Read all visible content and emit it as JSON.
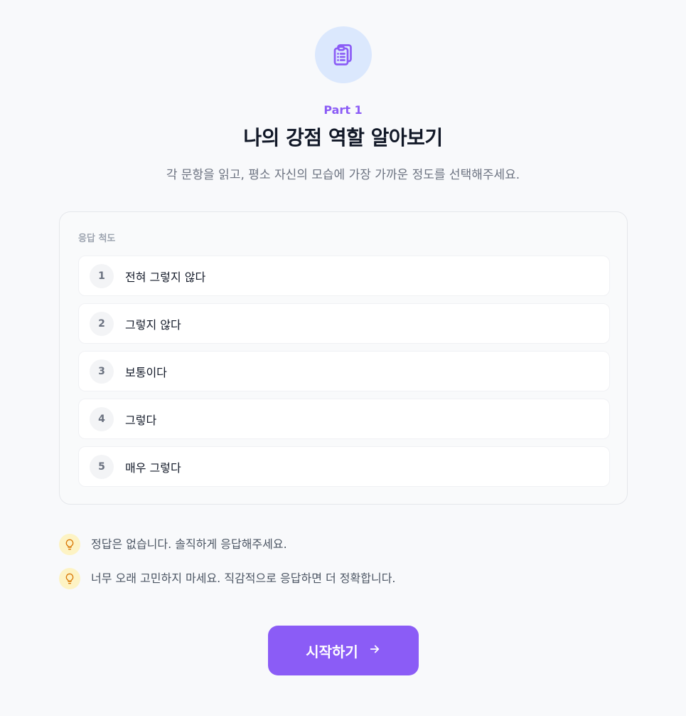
{
  "header": {
    "icon": "clipboard-list-icon",
    "part_label": "Part 1",
    "title": "나의 강점 역할 알아보기",
    "subtitle": "각 문항을 읽고, 평소 자신의 모습에 가장 가까운 정도를 선택해주세요."
  },
  "scale": {
    "heading": "응답 척도",
    "items": [
      {
        "number": "1",
        "label": "전혀 그렇지 않다"
      },
      {
        "number": "2",
        "label": "그렇지 않다"
      },
      {
        "number": "3",
        "label": "보통이다"
      },
      {
        "number": "4",
        "label": "그렇다"
      },
      {
        "number": "5",
        "label": "매우 그렇다"
      }
    ]
  },
  "tips": [
    {
      "icon": "lightbulb-icon",
      "text": "정답은 없습니다. 솔직하게 응답해주세요."
    },
    {
      "icon": "lightbulb-icon",
      "text": "너무 오래 고민하지 마세요. 직감적으로 응답하면 더 정확합니다."
    }
  ],
  "start_button": {
    "label": "시작하기",
    "icon": "arrow-right-icon"
  },
  "colors": {
    "accent": "#8b5cf6",
    "icon_bg": "#dbe8fd",
    "tip_bg": "#fdf3c4",
    "tip_icon": "#d97706"
  }
}
